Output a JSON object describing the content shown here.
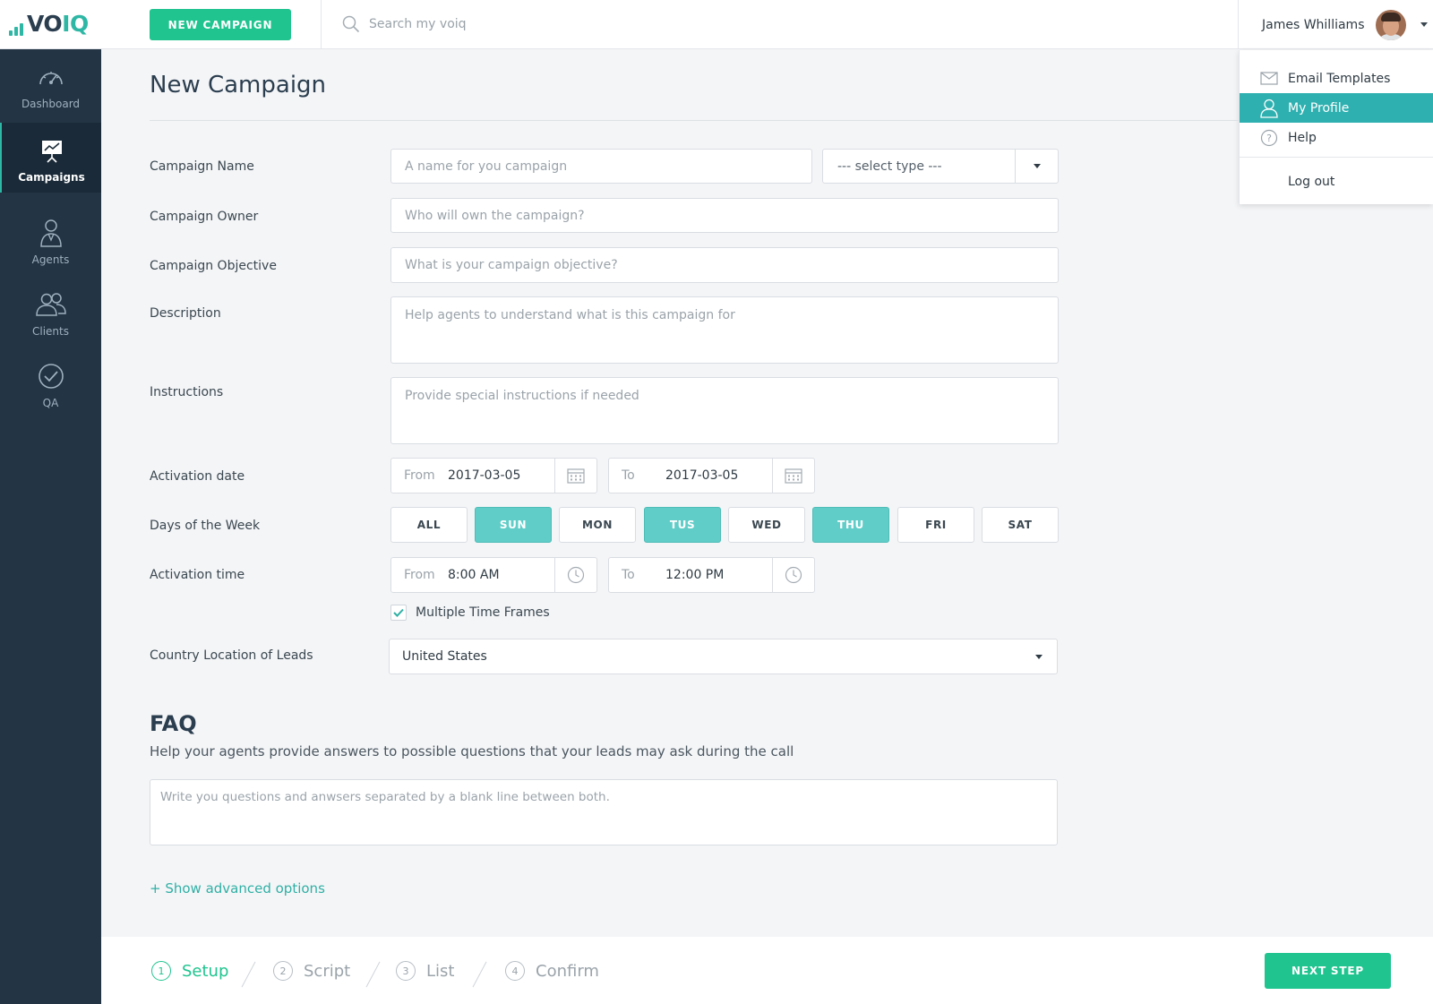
{
  "app": {
    "logo_text_part1": "VO",
    "logo_text_part2": "IQ",
    "brand_color": "#2fb7a5",
    "accent_green": "#1fc48f",
    "sidebar_color": "#233444"
  },
  "header": {
    "new_campaign_label": "NEW CAMPAIGN",
    "search_placeholder": "Search my voiq",
    "user_name": "James Whilliams"
  },
  "user_menu": {
    "items": [
      {
        "label": "Email Templates",
        "icon": "envelope-icon"
      },
      {
        "label": "My Profile",
        "icon": "user-icon",
        "active": true
      },
      {
        "label": "Help",
        "icon": "question-icon"
      },
      {
        "label": "Log out"
      }
    ]
  },
  "sidebar": {
    "items": [
      {
        "label": "Dashboard",
        "icon": "gauge-icon"
      },
      {
        "label": "Campaigns",
        "icon": "presentation-chart-icon",
        "active": true
      },
      {
        "label": "Agents",
        "icon": "agent-icon"
      },
      {
        "label": "Clients",
        "icon": "clients-icon"
      },
      {
        "label": "QA",
        "icon": "check-circle-icon"
      }
    ]
  },
  "page": {
    "title": "New Campaign"
  },
  "form": {
    "campaign_name": {
      "label": "Campaign Name",
      "placeholder": "A name for you campaign",
      "type_select": "--- select type ---"
    },
    "campaign_owner": {
      "label": "Campaign Owner",
      "placeholder": "Who will own the campaign?"
    },
    "campaign_objective": {
      "label": "Campaign Objective",
      "placeholder": "What is your campaign objective?"
    },
    "description": {
      "label": "Description",
      "placeholder": "Help agents to understand what is this campaign for"
    },
    "instructions": {
      "label": "Instructions",
      "placeholder": "Provide special instructions if needed"
    },
    "activation_date": {
      "label": "Activation date",
      "from_label": "From",
      "from_value": "2017-03-05",
      "to_label": "To",
      "to_value": "2017-03-05"
    },
    "days": {
      "label": "Days of the Week",
      "options": [
        {
          "label": "ALL",
          "selected": false
        },
        {
          "label": "SUN",
          "selected": true
        },
        {
          "label": "MON",
          "selected": false
        },
        {
          "label": "TUS",
          "selected": true
        },
        {
          "label": "WED",
          "selected": false
        },
        {
          "label": "THU",
          "selected": true
        },
        {
          "label": "FRI",
          "selected": false
        },
        {
          "label": "SAT",
          "selected": false
        }
      ]
    },
    "activation_time": {
      "label": "Activation time",
      "from_label": "From",
      "from_value": "8:00 AM",
      "to_label": "To",
      "to_value": "12:00 PM"
    },
    "multiple_time_frames": {
      "label": "Multiple Time Frames",
      "checked": true
    },
    "country": {
      "label": "Country Location of Leads",
      "value": "United States"
    }
  },
  "faq": {
    "title": "FAQ",
    "subtitle": "Help your agents provide answers to possible questions that your leads may ask during the call",
    "placeholder": "Write you questions and anwsers separated by a blank line between both."
  },
  "advanced_link": "+ Show advanced options",
  "footer": {
    "steps": [
      {
        "num": "1",
        "label": "Setup",
        "active": true
      },
      {
        "num": "2",
        "label": "Script"
      },
      {
        "num": "3",
        "label": "List"
      },
      {
        "num": "4",
        "label": "Confirm"
      }
    ],
    "next_label": "NEXT STEP"
  }
}
